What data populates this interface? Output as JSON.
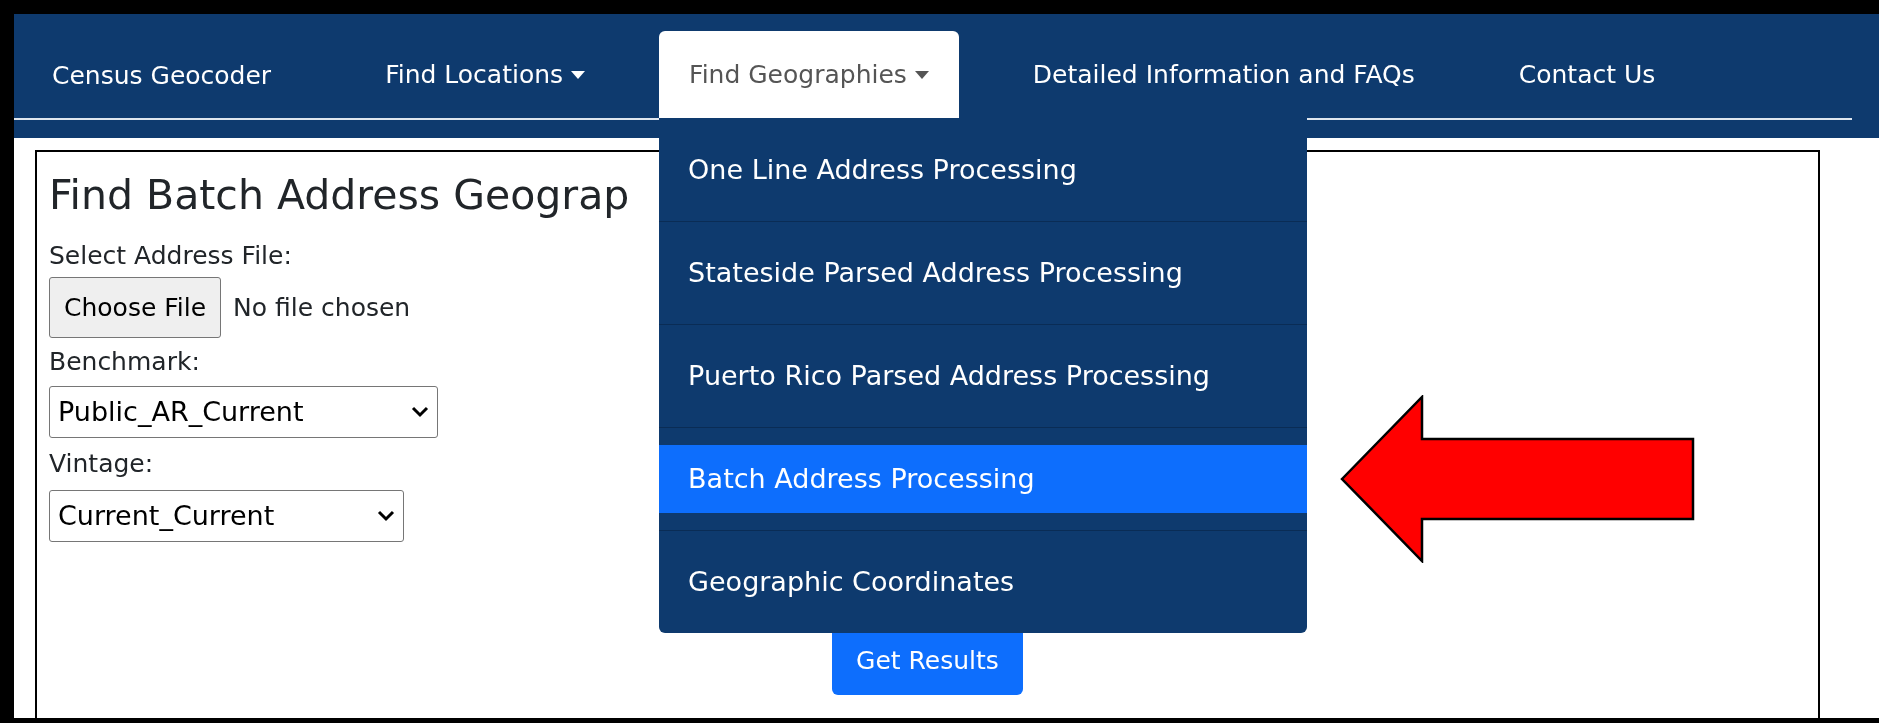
{
  "nav": {
    "brand": "Census Geocoder",
    "items": [
      {
        "label": "Find Locations",
        "dropdown": true,
        "selected": false
      },
      {
        "label": "Find Geographies",
        "dropdown": true,
        "selected": true
      },
      {
        "label": "Detailed Information and FAQs",
        "dropdown": false,
        "selected": false
      },
      {
        "label": "Contact Us",
        "dropdown": false,
        "selected": false
      }
    ]
  },
  "menu": {
    "items": [
      {
        "label": "One Line Address Processing",
        "selected": false
      },
      {
        "label": "Stateside Parsed Address Processing",
        "selected": false
      },
      {
        "label": "Puerto Rico Parsed Address Processing",
        "selected": false
      },
      {
        "label": "Batch Address Processing",
        "selected": true
      },
      {
        "label": "Geographic Coordinates",
        "selected": false
      }
    ]
  },
  "form": {
    "heading": "Find Batch Address Geograp",
    "file_label": "Select Address File:",
    "file_button": "Choose File",
    "file_status": "No file chosen",
    "benchmark": {
      "label": "Benchmark:",
      "value": "Public_AR_Current"
    },
    "vintage": {
      "label": "Vintage:",
      "value": "Current_Current"
    },
    "submit": "Get Results"
  }
}
